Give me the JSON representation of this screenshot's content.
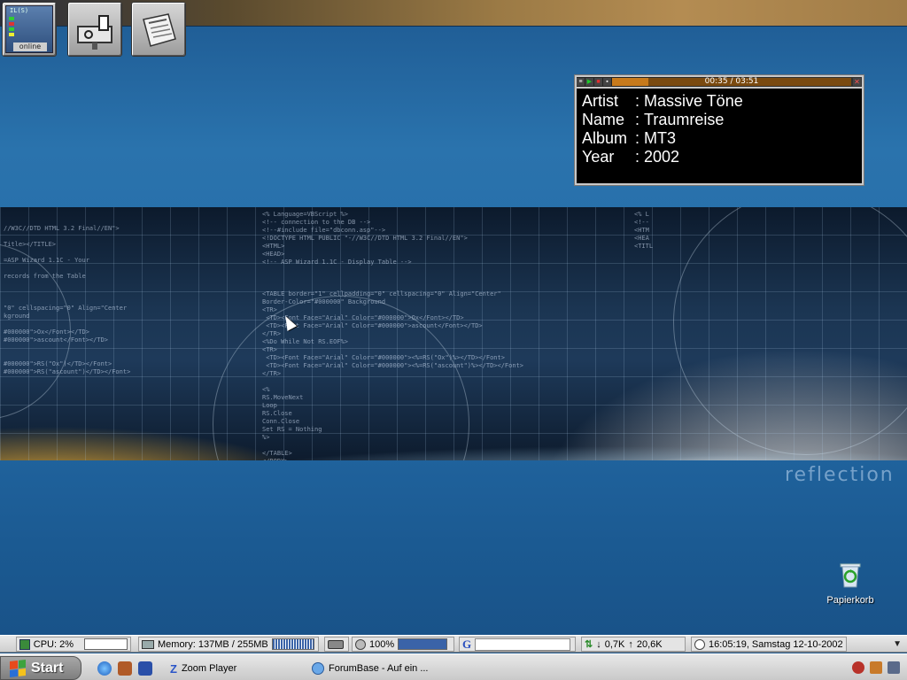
{
  "desktop": {
    "icons_top": [
      {
        "name": "network-monitor",
        "label": "online",
        "monitor_text": "IL(S)"
      },
      {
        "name": "mailbox"
      },
      {
        "name": "newspaper"
      }
    ],
    "wallpaper_word": "reflection",
    "recycle_bin": {
      "label": "Papierkorb"
    }
  },
  "player": {
    "time": "00:35 / 03:51",
    "progress_fraction": 0.15,
    "rows": [
      {
        "label": "Artist",
        "value": "Massive Töne"
      },
      {
        "label": "Name",
        "value": "Traumreise"
      },
      {
        "label": "Album",
        "value": "MT3"
      },
      {
        "label": "Year",
        "value": "2002"
      }
    ],
    "separator": ":"
  },
  "infobar": {
    "cpu": "CPU: 2%",
    "memory": "Memory: 137MB / 255MB",
    "volume": "100%",
    "volume_fraction": 1.0,
    "google_letter": "G",
    "net_down": "0,7K",
    "net_up": "20,6K",
    "datetime": "16:05:19, Samstag 12-10-2002"
  },
  "taskbar": {
    "start_label": "Start",
    "tasks": [
      {
        "label": "Zoom Player"
      },
      {
        "label": "ForumBase - Auf ein ..."
      }
    ]
  },
  "colors": {
    "desktop_blue": "#2a73ad",
    "player_bg": "#000000",
    "progress": "#c77a1c",
    "taskbar": "#cfcfcf"
  }
}
